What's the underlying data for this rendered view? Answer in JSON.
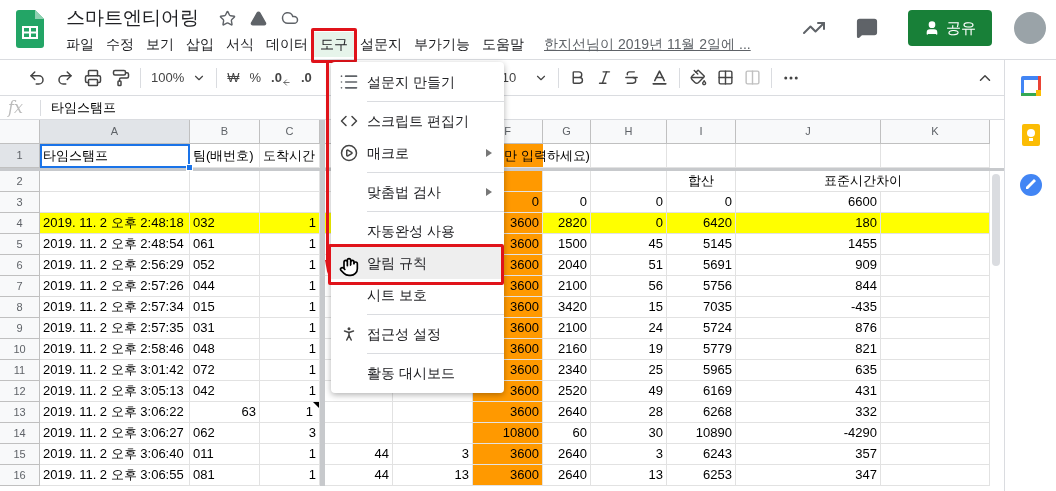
{
  "doc": {
    "title": "스마트엔티어링",
    "last_edit": "한지선님이 2019년 11월 2일에 ...",
    "share": "공유"
  },
  "menubar": [
    {
      "label": "파일",
      "selected": false
    },
    {
      "label": "수정",
      "selected": false
    },
    {
      "label": "보기",
      "selected": false
    },
    {
      "label": "삽입",
      "selected": false
    },
    {
      "label": "서식",
      "selected": false
    },
    {
      "label": "데이터",
      "selected": false
    },
    {
      "label": "도구",
      "selected": true
    },
    {
      "label": "설문지",
      "selected": false
    },
    {
      "label": "부가기능",
      "selected": false
    },
    {
      "label": "도움말",
      "selected": false
    }
  ],
  "toolbar": {
    "zoom": "100%",
    "currency": "₩",
    "percent": "%",
    "dec_less": ".0",
    "dec_more": ".0",
    "font_size": "10"
  },
  "formula": {
    "label": "fx",
    "value": "타임스탬프"
  },
  "columns": [
    {
      "letter": "A",
      "selected": true,
      "shaded": false
    },
    {
      "letter": "B",
      "selected": false,
      "shaded": false
    },
    {
      "letter": "C",
      "selected": false,
      "shaded": false
    },
    {
      "shaded": false
    },
    {
      "shaded": false
    },
    {
      "letter": "F",
      "selected": false,
      "shaded": true
    },
    {
      "letter": "G",
      "selected": false,
      "shaded": false
    },
    {
      "letter": "H",
      "selected": false,
      "shaded": false
    },
    {
      "letter": "I",
      "selected": false,
      "shaded": false
    },
    {
      "letter": "J",
      "selected": false,
      "shaded": false
    },
    {
      "letter": "K",
      "selected": false,
      "shaded": false
    }
  ],
  "rows": [
    {
      "num": "1",
      "selected": true,
      "highlighted": false,
      "cells": [
        {
          "text": "타임스탬프",
          "kind": "text"
        },
        {
          "text": "팀(배번호)",
          "kind": "text"
        },
        {
          "text": "도착시간",
          "kind": "text"
        },
        null,
        null,
        {
          "text": "만 입력하세요)",
          "kind": "overflow"
        },
        null,
        null,
        null,
        null,
        null
      ]
    },
    {
      "num": "2",
      "selected": false,
      "highlighted": false,
      "cells": [
        null,
        null,
        null,
        null,
        null,
        null,
        null,
        null,
        {
          "text": "합산",
          "kind": "center"
        },
        {
          "text": "표준시간차이",
          "kind": "merged"
        },
        null
      ]
    },
    {
      "num": "3",
      "selected": false,
      "highlighted": false,
      "cells": [
        null,
        null,
        null,
        null,
        null,
        {
          "text": "0",
          "kind": "number"
        },
        {
          "text": "0",
          "kind": "number"
        },
        {
          "text": "0",
          "kind": "number"
        },
        {
          "text": "0",
          "kind": "number"
        },
        {
          "text": "6600",
          "kind": "number"
        },
        null
      ]
    },
    {
      "num": "4",
      "selected": false,
      "highlighted": true,
      "cells": [
        {
          "text": "2019. 11. 2 오후 2:48:18",
          "kind": "text"
        },
        {
          "text": "032",
          "kind": "text"
        },
        {
          "text": "1",
          "kind": "number"
        },
        null,
        null,
        {
          "text": "3600",
          "kind": "number"
        },
        {
          "text": "2820",
          "kind": "number"
        },
        {
          "text": "0",
          "kind": "number"
        },
        {
          "text": "6420",
          "kind": "number"
        },
        {
          "text": "180",
          "kind": "number"
        },
        null
      ]
    },
    {
      "num": "5",
      "selected": false,
      "highlighted": false,
      "cells": [
        {
          "text": "2019. 11. 2 오후 2:48:54",
          "kind": "text"
        },
        {
          "text": "061",
          "kind": "text"
        },
        {
          "text": "1",
          "kind": "number"
        },
        null,
        null,
        {
          "text": "3600",
          "kind": "number"
        },
        {
          "text": "1500",
          "kind": "number"
        },
        {
          "text": "45",
          "kind": "number"
        },
        {
          "text": "5145",
          "kind": "number"
        },
        {
          "text": "1455",
          "kind": "number"
        },
        null
      ]
    },
    {
      "num": "6",
      "selected": false,
      "highlighted": false,
      "cells": [
        {
          "text": "2019. 11. 2 오후 2:56:29",
          "kind": "text"
        },
        {
          "text": "052",
          "kind": "text"
        },
        {
          "text": "1",
          "kind": "number"
        },
        null,
        null,
        {
          "text": "3600",
          "kind": "number"
        },
        {
          "text": "2040",
          "kind": "number"
        },
        {
          "text": "51",
          "kind": "number"
        },
        {
          "text": "5691",
          "kind": "number"
        },
        {
          "text": "909",
          "kind": "number"
        },
        null
      ]
    },
    {
      "num": "7",
      "selected": false,
      "highlighted": false,
      "cells": [
        {
          "text": "2019. 11. 2 오후 2:57:26",
          "kind": "text"
        },
        {
          "text": "044",
          "kind": "text"
        },
        {
          "text": "1",
          "kind": "number"
        },
        null,
        null,
        {
          "text": "3600",
          "kind": "number"
        },
        {
          "text": "2100",
          "kind": "number"
        },
        {
          "text": "56",
          "kind": "number"
        },
        {
          "text": "5756",
          "kind": "number"
        },
        {
          "text": "844",
          "kind": "number"
        },
        null
      ]
    },
    {
      "num": "8",
      "selected": false,
      "highlighted": false,
      "cells": [
        {
          "text": "2019. 11. 2 오후 2:57:34",
          "kind": "text"
        },
        {
          "text": "015",
          "kind": "text"
        },
        {
          "text": "1",
          "kind": "number"
        },
        null,
        null,
        {
          "text": "3600",
          "kind": "number"
        },
        {
          "text": "3420",
          "kind": "number"
        },
        {
          "text": "15",
          "kind": "number"
        },
        {
          "text": "7035",
          "kind": "number"
        },
        {
          "text": "-435",
          "kind": "number"
        },
        null
      ]
    },
    {
      "num": "9",
      "selected": false,
      "highlighted": false,
      "cells": [
        {
          "text": "2019. 11. 2 오후 2:57:35",
          "kind": "text"
        },
        {
          "text": "031",
          "kind": "text"
        },
        {
          "text": "1",
          "kind": "number"
        },
        null,
        null,
        {
          "text": "3600",
          "kind": "number"
        },
        {
          "text": "2100",
          "kind": "number"
        },
        {
          "text": "24",
          "kind": "number"
        },
        {
          "text": "5724",
          "kind": "number"
        },
        {
          "text": "876",
          "kind": "number"
        },
        null
      ]
    },
    {
      "num": "10",
      "selected": false,
      "highlighted": false,
      "cells": [
        {
          "text": "2019. 11. 2 오후 2:58:46",
          "kind": "text"
        },
        {
          "text": "048",
          "kind": "text"
        },
        {
          "text": "1",
          "kind": "number"
        },
        null,
        null,
        {
          "text": "3600",
          "kind": "number"
        },
        {
          "text": "2160",
          "kind": "number"
        },
        {
          "text": "19",
          "kind": "number"
        },
        {
          "text": "5779",
          "kind": "number"
        },
        {
          "text": "821",
          "kind": "number"
        },
        null
      ]
    },
    {
      "num": "11",
      "selected": false,
      "highlighted": false,
      "cells": [
        {
          "text": "2019. 11. 2 오후 3:01:42",
          "kind": "text"
        },
        {
          "text": "072",
          "kind": "text"
        },
        {
          "text": "1",
          "kind": "number"
        },
        null,
        null,
        {
          "text": "3600",
          "kind": "number"
        },
        {
          "text": "2340",
          "kind": "number"
        },
        {
          "text": "25",
          "kind": "number"
        },
        {
          "text": "5965",
          "kind": "number"
        },
        {
          "text": "635",
          "kind": "number"
        },
        null
      ]
    },
    {
      "num": "12",
      "selected": false,
      "highlighted": false,
      "cells": [
        {
          "text": "2019. 11. 2 오후 3:05:13",
          "kind": "text"
        },
        {
          "text": "042",
          "kind": "text"
        },
        {
          "text": "1",
          "kind": "number"
        },
        null,
        null,
        {
          "text": "3600",
          "kind": "number"
        },
        {
          "text": "2520",
          "kind": "number"
        },
        {
          "text": "49",
          "kind": "number"
        },
        {
          "text": "6169",
          "kind": "number"
        },
        {
          "text": "431",
          "kind": "number"
        },
        null
      ]
    },
    {
      "num": "13",
      "selected": false,
      "highlighted": false,
      "cells": [
        {
          "text": "2019. 11. 2 오후 3:06:22",
          "kind": "text"
        },
        {
          "text": "63",
          "kind": "number"
        },
        {
          "text": "1",
          "kind": "noted"
        },
        null,
        null,
        {
          "text": "3600",
          "kind": "number"
        },
        {
          "text": "2640",
          "kind": "number"
        },
        {
          "text": "28",
          "kind": "number"
        },
        {
          "text": "6268",
          "kind": "number"
        },
        {
          "text": "332",
          "kind": "number"
        },
        null
      ]
    },
    {
      "num": "14",
      "selected": false,
      "highlighted": false,
      "cells": [
        {
          "text": "2019. 11. 2 오후 3:06:27",
          "kind": "text"
        },
        {
          "text": "062",
          "kind": "text"
        },
        {
          "text": "3",
          "kind": "number"
        },
        null,
        null,
        {
          "text": "10800",
          "kind": "number"
        },
        {
          "text": "60",
          "kind": "number"
        },
        {
          "text": "30",
          "kind": "number"
        },
        {
          "text": "10890",
          "kind": "number"
        },
        {
          "text": "-4290",
          "kind": "number"
        },
        null
      ]
    },
    {
      "num": "15",
      "selected": false,
      "highlighted": false,
      "cells": [
        {
          "text": "2019. 11. 2 오후 3:06:40",
          "kind": "text"
        },
        {
          "text": "011",
          "kind": "text"
        },
        {
          "text": "1",
          "kind": "number"
        },
        {
          "text": "44",
          "kind": "number"
        },
        {
          "text": "3",
          "kind": "number"
        },
        {
          "text": "3600",
          "kind": "number"
        },
        {
          "text": "2640",
          "kind": "number"
        },
        {
          "text": "3",
          "kind": "number"
        },
        {
          "text": "6243",
          "kind": "number"
        },
        {
          "text": "357",
          "kind": "number"
        },
        null
      ]
    },
    {
      "num": "16",
      "selected": false,
      "highlighted": false,
      "cells": [
        {
          "text": "2019. 11. 2 오후 3:06:55",
          "kind": "text"
        },
        {
          "text": "081",
          "kind": "text"
        },
        {
          "text": "1",
          "kind": "number"
        },
        {
          "text": "44",
          "kind": "number"
        },
        {
          "text": "13",
          "kind": "number"
        },
        {
          "text": "3600",
          "kind": "number"
        },
        {
          "text": "2640",
          "kind": "number"
        },
        {
          "text": "13",
          "kind": "number"
        },
        {
          "text": "6253",
          "kind": "number"
        },
        {
          "text": "347",
          "kind": "number"
        },
        null
      ]
    }
  ],
  "menu": {
    "groups": [
      [
        {
          "label": "설문지 만들기",
          "kind": "form",
          "submenu": false,
          "hovered": false
        }
      ],
      [
        {
          "label": "스크립트 편집기",
          "kind": "code",
          "submenu": false,
          "hovered": false
        },
        {
          "label": "매크로",
          "kind": "macro",
          "submenu": true,
          "hovered": false
        }
      ],
      [
        {
          "label": "맞춤법 검사",
          "kind": "plain",
          "submenu": true,
          "hovered": false
        }
      ],
      [
        {
          "label": "자동완성 사용",
          "kind": "plain",
          "submenu": false,
          "hovered": false
        },
        {
          "label": "알림 규칙",
          "kind": "plain",
          "submenu": false,
          "hovered": true
        },
        {
          "label": "시트 보호",
          "kind": "plain",
          "submenu": false,
          "hovered": false
        }
      ],
      [
        {
          "label": "접근성 설정",
          "kind": "accessibility",
          "submenu": false,
          "hovered": false
        }
      ],
      [
        {
          "label": "활동 대시보드",
          "kind": "plain",
          "submenu": false,
          "hovered": false
        }
      ]
    ]
  }
}
